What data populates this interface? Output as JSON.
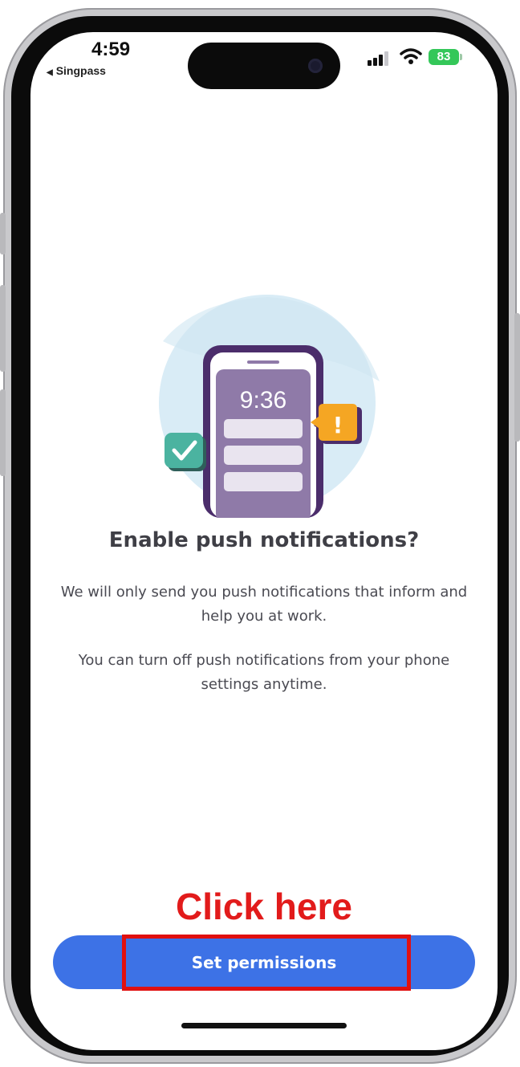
{
  "status_bar": {
    "time": "4:59",
    "back_label": "Singpass",
    "battery": "83"
  },
  "illustration": {
    "clock": "9:36",
    "alert_mark": "!",
    "icons": [
      "phone-illustration",
      "checkmark-bubble-icon",
      "alert-bubble-icon"
    ]
  },
  "dialog": {
    "title": "Enable push notifications?",
    "paragraph_1": "We will only send you push notifications that inform and help you at work.",
    "paragraph_2": "You can turn off push notifications from your phone settings anytime."
  },
  "annotation": {
    "label": "Click here"
  },
  "actions": {
    "primary_label": "Set permissions"
  },
  "colors": {
    "accent": "#3d72e6",
    "annotation_red": "#e21b1b",
    "phone_purple": "#4b2d6b",
    "check_green": "#4bb3a0",
    "alert_orange": "#f5a623"
  }
}
